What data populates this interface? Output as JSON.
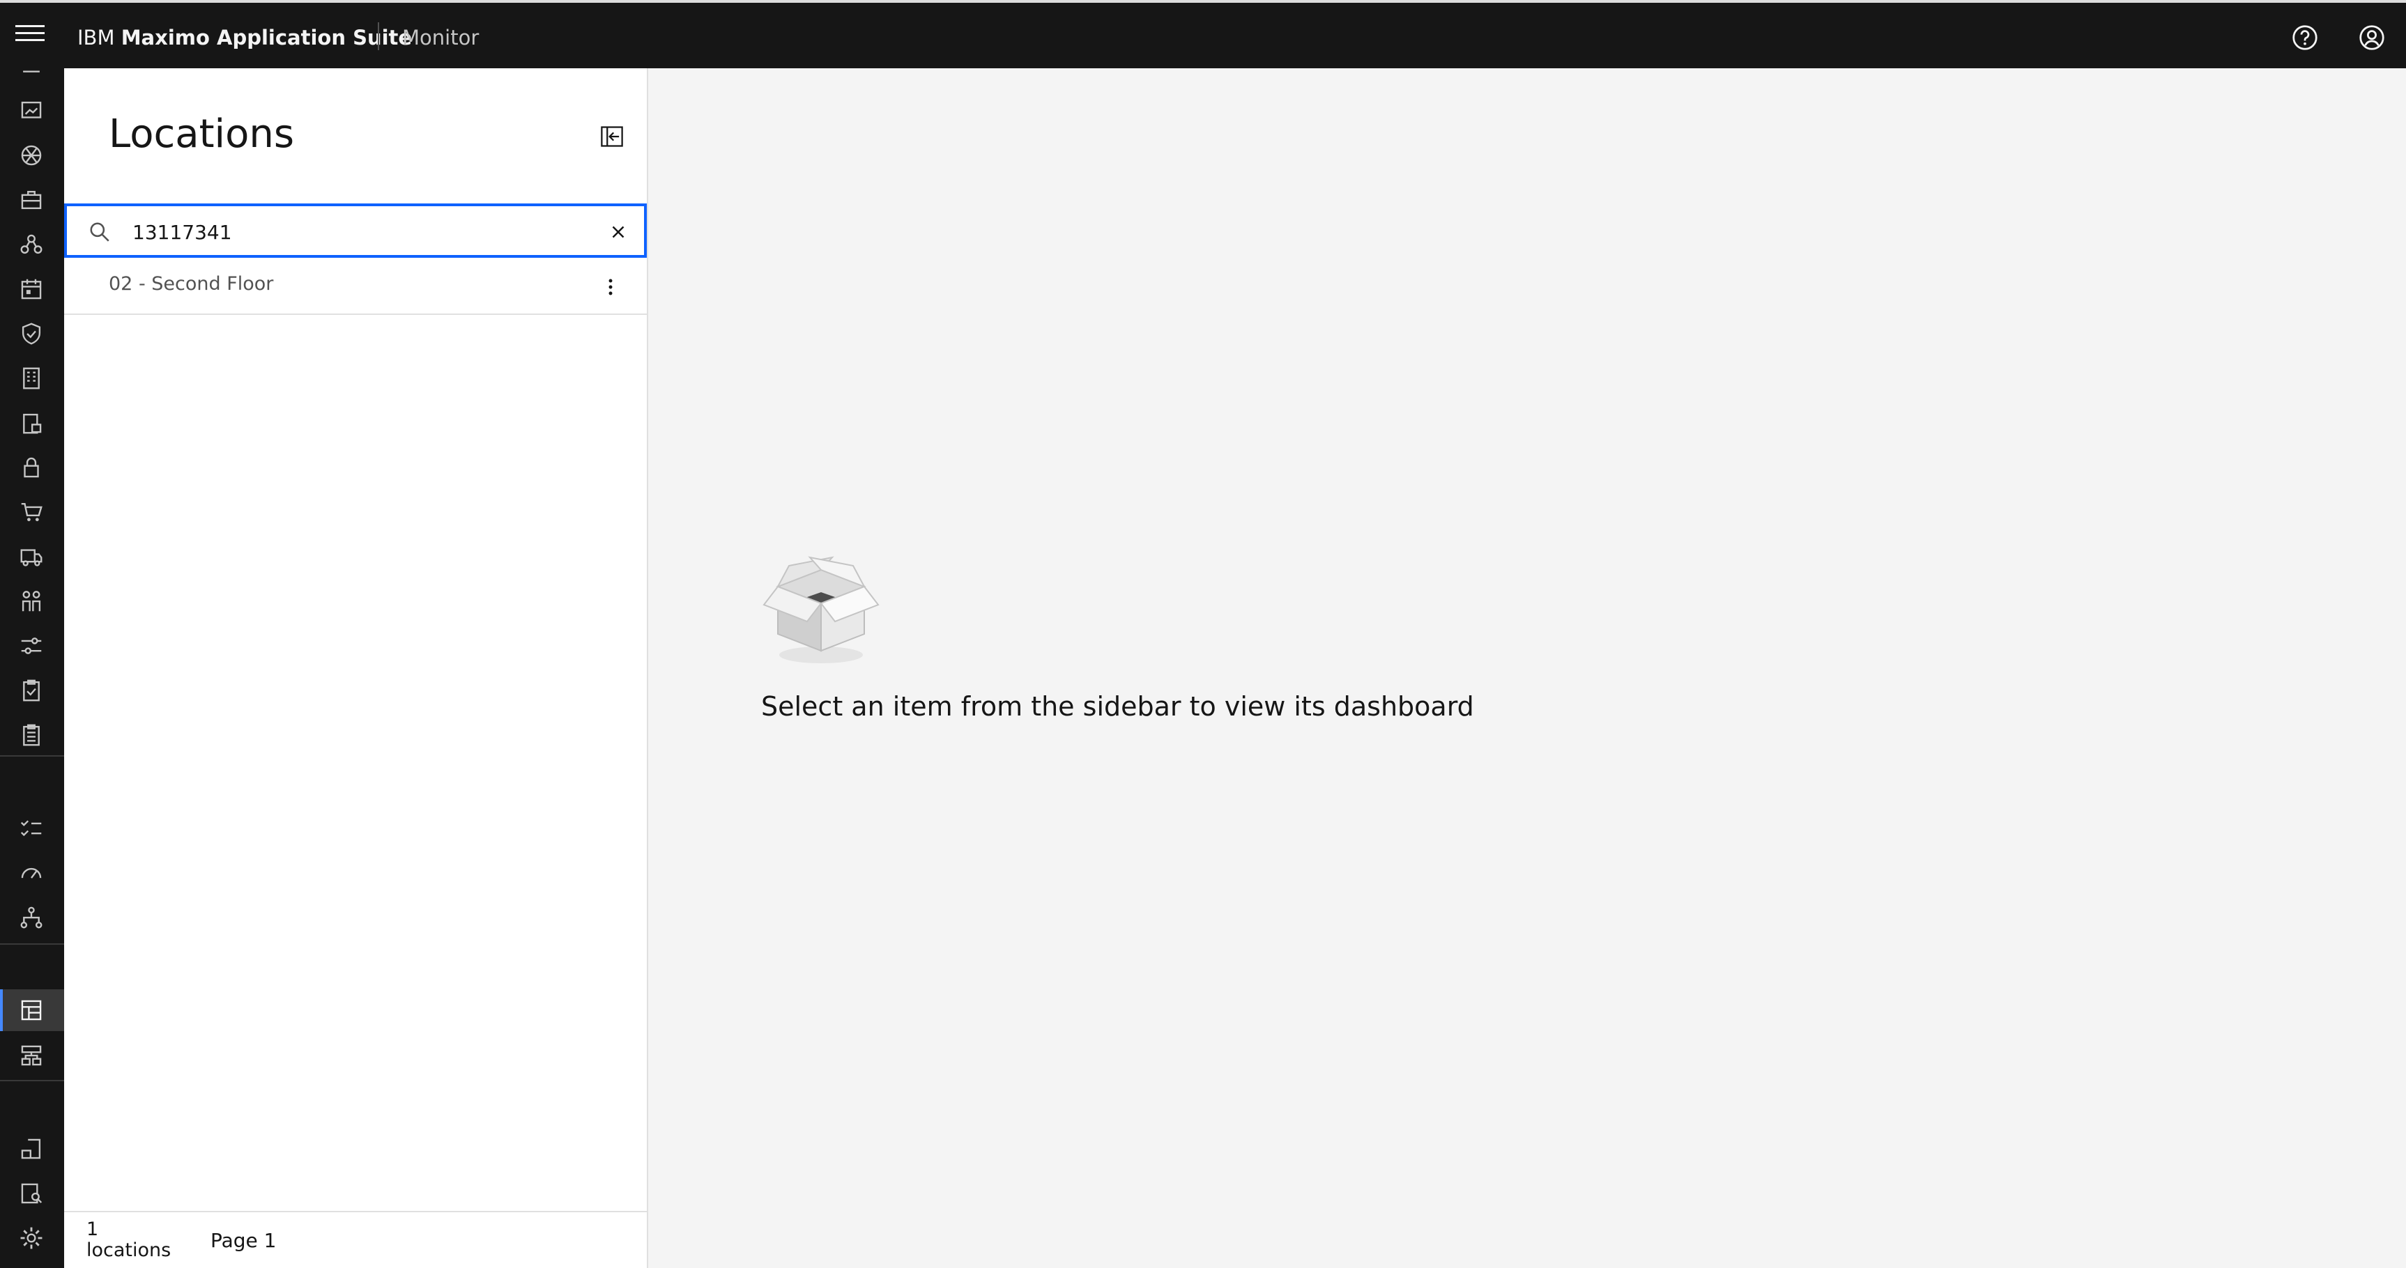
{
  "header": {
    "brand_prefix": "IBM",
    "brand_name": "Maximo Application Suite",
    "app_name": "Monitor",
    "icons": [
      "hamburger-menu-icon",
      "help-icon",
      "user-profile-icon"
    ]
  },
  "rail": {
    "icons": [
      "doc-icon",
      "media-icon",
      "aperture-icon",
      "toolbox-icon",
      "network-icon",
      "calendar-icon",
      "shield-check-icon",
      "building-icon",
      "clipboard-lock-icon",
      "lock-icon",
      "cart-icon",
      "truck-icon",
      "people-icon",
      "settings-adjust-icon",
      "clipboard-check-icon",
      "clipboard-list-icon",
      "task-list-icon",
      "gauge-icon",
      "hierarchy-icon",
      "dashboard-grid-icon",
      "data-structure-icon",
      "report-icon",
      "search-doc-icon",
      "gear-icon"
    ],
    "active": "dashboard-grid-icon"
  },
  "sidebar": {
    "title": "Locations",
    "search": {
      "value": "13117341",
      "placeholder": ""
    },
    "items": [
      {
        "label": "02 - Second Floor"
      }
    ],
    "footer": {
      "count": "1",
      "count_unit": "locations",
      "page": "Page 1"
    }
  },
  "main": {
    "empty_message": "Select an item from the sidebar to view its dashboard"
  },
  "colors": {
    "header_bg": "#161616",
    "focus_blue": "#0f62fe",
    "main_bg": "#f4f4f4"
  }
}
